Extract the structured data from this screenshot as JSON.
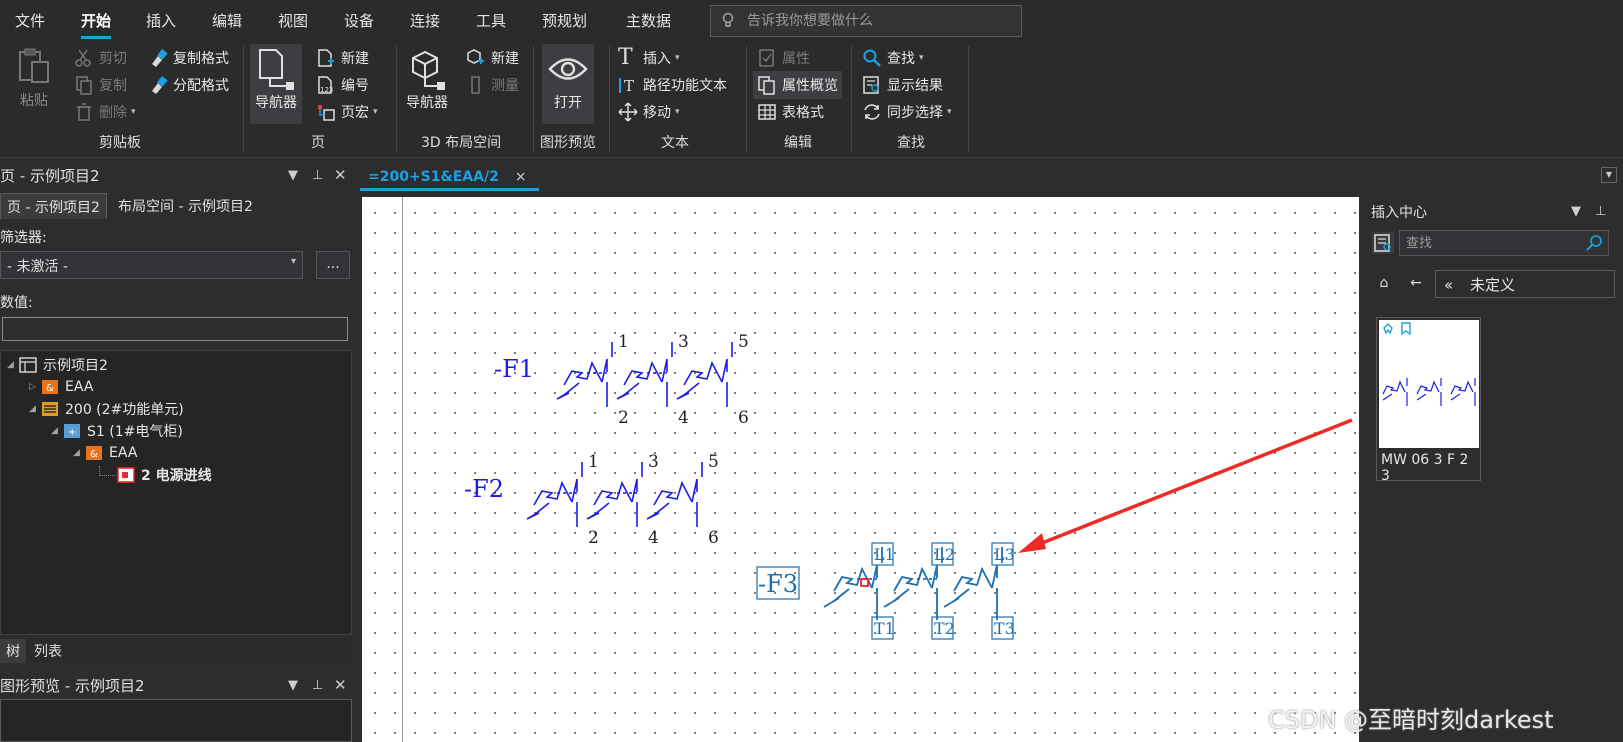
{
  "menu": {
    "items": [
      "文件",
      "开始",
      "插入",
      "编辑",
      "视图",
      "设备",
      "连接",
      "工具",
      "预规划",
      "主数据"
    ],
    "active": "开始",
    "tell_placeholder": "告诉我你想要做什么"
  },
  "ribbon": {
    "clipboard": {
      "paste": "粘贴",
      "cut": "剪切",
      "copy": "复制",
      "delete": "删除",
      "copy_format": "复制格式",
      "assign_format": "分配格式",
      "label": "剪贴板"
    },
    "page": {
      "navigator": "导航器",
      "new": "新建",
      "number": "编号",
      "page_macro": "页宏",
      "label": "页"
    },
    "layout3d": {
      "navigator": "导航器",
      "new": "新建",
      "measure": "测量",
      "label": "3D 布局空间"
    },
    "preview": {
      "open": "打开",
      "label": "图形预览"
    },
    "text": {
      "insert": "插入",
      "path_text": "路径功能文本",
      "move": "移动",
      "label": "文本"
    },
    "edit": {
      "properties": "属性",
      "prop_overview": "属性概览",
      "table_format": "表格式",
      "label": "编辑"
    },
    "find": {
      "find": "查找",
      "show_results": "显示结果",
      "sync_select": "同步选择",
      "label": "查找"
    }
  },
  "left_panel": {
    "title": "页 - 示例项目2",
    "tabs": [
      "页 - 示例项目2",
      "布局空间 - 示例项目2"
    ],
    "filter_label": "筛选器:",
    "filter_value": "- 未激活 -",
    "filter_more": "...",
    "value_label": "数值:",
    "tree": [
      {
        "label": "示例项目2",
        "icon": "project-icon"
      },
      {
        "label": "EAA",
        "icon": "function-icon"
      },
      {
        "label": "200 (2#功能单元)",
        "icon": "unit-icon"
      },
      {
        "label": "S1 (1#电气柜)",
        "icon": "cabinet-icon"
      },
      {
        "label": "EAA",
        "icon": "function-icon"
      },
      {
        "label": "2 电源进线",
        "icon": "page-icon"
      }
    ],
    "bottom_tabs": [
      "树",
      "列表"
    ],
    "preview_title": "图形预览 - 示例项目2"
  },
  "document": {
    "tab": "=200+S1&EAA/2",
    "close": "×"
  },
  "schematic": {
    "devices": [
      {
        "tag": "-F1",
        "top": [
          "1",
          "3",
          "5"
        ],
        "bottom": [
          "2",
          "4",
          "6"
        ]
      },
      {
        "tag": "-F2",
        "top": [
          "1",
          "3",
          "5"
        ],
        "bottom": [
          "2",
          "4",
          "6"
        ]
      },
      {
        "tag": "-F3",
        "top": [
          "L1",
          "L2",
          "L3"
        ],
        "bottom": [
          "T1",
          "T2",
          "T3"
        ]
      }
    ]
  },
  "right_panel": {
    "title": "插入中心",
    "search_placeholder": "查找",
    "path": "未定义",
    "macro_name": "MW 06 3 F 2 3"
  },
  "watermark": "CSDN @至暗时刻darkest",
  "colors": {
    "accent": "#1ba1e2",
    "schematic_blue": "#1e1ee6",
    "selected_blue": "#1c6fb0",
    "arrow_red": "#ee2a24"
  }
}
